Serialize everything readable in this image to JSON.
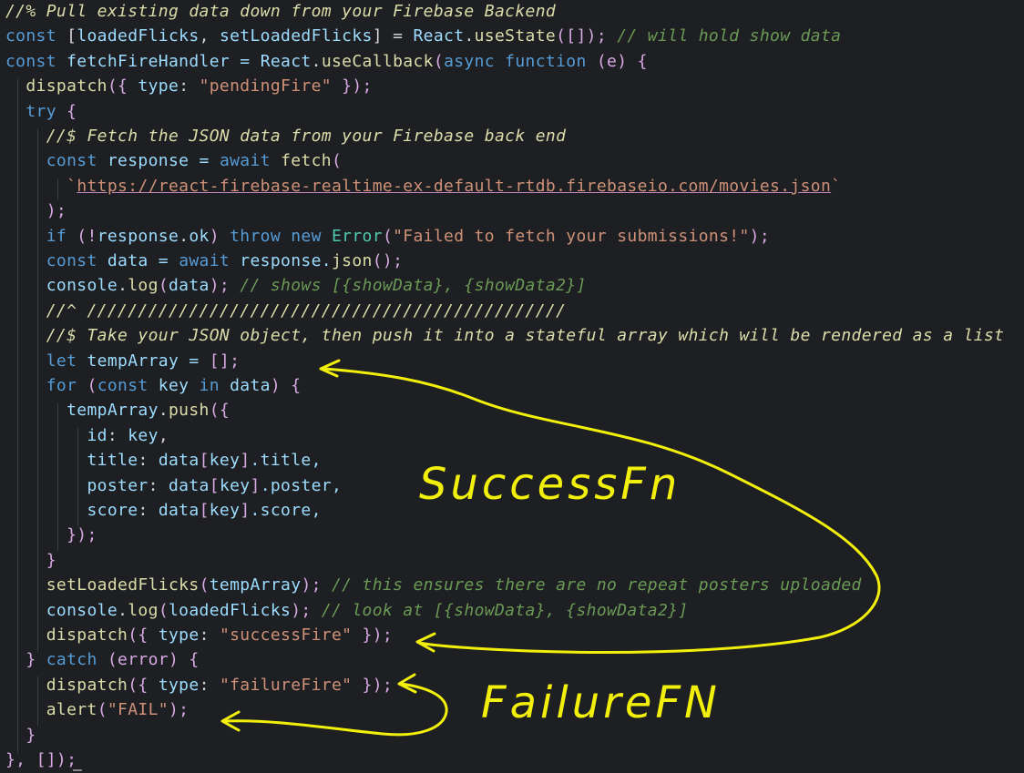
{
  "colors": {
    "background": "#1e1f22",
    "comment_green": "#6a9955",
    "keyword_blue": "#569cd6",
    "function_yellow": "#dcdcaa",
    "string_orange": "#ce9178",
    "annotation_yellow": "#f2f00b"
  },
  "code_lines": [
    [
      {
        "t": "//% Pull existing data down from your Firebase Backend",
        "c": "ch"
      }
    ],
    [
      {
        "t": "const",
        "c": "kw"
      },
      {
        "t": " [",
        "c": "p"
      },
      {
        "t": "loadedFlicks",
        "c": "v"
      },
      {
        "t": ", ",
        "c": "p"
      },
      {
        "t": "setLoadedFlicks",
        "c": "v"
      },
      {
        "t": "] = ",
        "c": "p"
      },
      {
        "t": "React",
        "c": "v"
      },
      {
        "t": ".",
        "c": "p"
      },
      {
        "t": "useState",
        "c": "fn"
      },
      {
        "t": "([]); ",
        "c": "br"
      },
      {
        "t": "// will hold show data",
        "c": "cm"
      }
    ],
    [
      {
        "t": "const",
        "c": "kw"
      },
      {
        "t": " fetchFireHandler = ",
        "c": "v"
      },
      {
        "t": "React",
        "c": "v"
      },
      {
        "t": ".",
        "c": "p"
      },
      {
        "t": "useCallback",
        "c": "fn"
      },
      {
        "t": "(",
        "c": "br"
      },
      {
        "t": "async function",
        "c": "kw"
      },
      {
        "t": " (e) {",
        "c": "br"
      }
    ],
    [
      {
        "t": "  ",
        "c": "p"
      },
      {
        "t": "dispatch",
        "c": "fn"
      },
      {
        "t": "({ ",
        "c": "br"
      },
      {
        "t": "type",
        "c": "v"
      },
      {
        "t": ": ",
        "c": "p"
      },
      {
        "t": "\"pendingFire\"",
        "c": "str"
      },
      {
        "t": " });",
        "c": "br"
      }
    ],
    [
      {
        "t": "  ",
        "c": "p"
      },
      {
        "t": "try",
        "c": "kw"
      },
      {
        "t": " {",
        "c": "br"
      }
    ],
    [
      {
        "t": "    ",
        "c": "p"
      },
      {
        "t": "//$ Fetch the JSON data from your Firebase back end",
        "c": "ch"
      }
    ],
    [
      {
        "t": "    ",
        "c": "p"
      },
      {
        "t": "const",
        "c": "kw"
      },
      {
        "t": " response = ",
        "c": "v"
      },
      {
        "t": "await",
        "c": "kw"
      },
      {
        "t": " ",
        "c": "p"
      },
      {
        "t": "fetch",
        "c": "fn"
      },
      {
        "t": "(",
        "c": "br"
      }
    ],
    [
      {
        "t": "      ",
        "c": "p"
      },
      {
        "t": "`",
        "c": "str"
      },
      {
        "t": "https://react-firebase-realtime-ex-default-rtdb.firebaseio.com/movies.json",
        "c": "url"
      },
      {
        "t": "`",
        "c": "str"
      }
    ],
    [
      {
        "t": "    ",
        "c": "p"
      },
      {
        "t": ");",
        "c": "br"
      }
    ],
    [
      {
        "t": "    ",
        "c": "p"
      },
      {
        "t": "if",
        "c": "kw"
      },
      {
        "t": " (!",
        "c": "br"
      },
      {
        "t": "response",
        "c": "v"
      },
      {
        "t": ".",
        "c": "p"
      },
      {
        "t": "ok",
        "c": "v"
      },
      {
        "t": ") ",
        "c": "br"
      },
      {
        "t": "throw new",
        "c": "kw"
      },
      {
        "t": " ",
        "c": "p"
      },
      {
        "t": "Error",
        "c": "cls"
      },
      {
        "t": "(",
        "c": "br"
      },
      {
        "t": "\"Failed to fetch your submissions!\"",
        "c": "str"
      },
      {
        "t": ");",
        "c": "br"
      }
    ],
    [
      {
        "t": "    ",
        "c": "p"
      },
      {
        "t": "const",
        "c": "kw"
      },
      {
        "t": " data = ",
        "c": "v"
      },
      {
        "t": "await",
        "c": "kw"
      },
      {
        "t": " response.",
        "c": "v"
      },
      {
        "t": "json",
        "c": "fn"
      },
      {
        "t": "();",
        "c": "br"
      }
    ],
    [
      {
        "t": "    ",
        "c": "p"
      },
      {
        "t": "console",
        "c": "v"
      },
      {
        "t": ".",
        "c": "p"
      },
      {
        "t": "log",
        "c": "fn"
      },
      {
        "t": "(",
        "c": "br"
      },
      {
        "t": "data",
        "c": "v"
      },
      {
        "t": "); ",
        "c": "br"
      },
      {
        "t": "// shows [{showData}, {showData2}]",
        "c": "cm"
      }
    ],
    [
      {
        "t": "    ",
        "c": "p"
      },
      {
        "t": "//^ ///////////////////////////////////////////////",
        "c": "ch"
      }
    ],
    [
      {
        "t": "    ",
        "c": "p"
      },
      {
        "t": "//$ Take your JSON object, then push it into a stateful array which will be rendered as a list",
        "c": "ch"
      }
    ],
    [
      {
        "t": "    ",
        "c": "p"
      },
      {
        "t": "let",
        "c": "kw"
      },
      {
        "t": " tempArray = ",
        "c": "v"
      },
      {
        "t": "[];",
        "c": "br"
      }
    ],
    [
      {
        "t": "    ",
        "c": "p"
      },
      {
        "t": "for",
        "c": "kw"
      },
      {
        "t": " (",
        "c": "br"
      },
      {
        "t": "const",
        "c": "kw"
      },
      {
        "t": " key ",
        "c": "v"
      },
      {
        "t": "in",
        "c": "kw"
      },
      {
        "t": " data",
        "c": "v"
      },
      {
        "t": ") {",
        "c": "br"
      }
    ],
    [
      {
        "t": "      ",
        "c": "p"
      },
      {
        "t": "tempArray",
        "c": "v"
      },
      {
        "t": ".",
        "c": "p"
      },
      {
        "t": "push",
        "c": "fn"
      },
      {
        "t": "({",
        "c": "br"
      }
    ],
    [
      {
        "t": "        ",
        "c": "p"
      },
      {
        "t": "id",
        "c": "v"
      },
      {
        "t": ": ",
        "c": "p"
      },
      {
        "t": "key",
        "c": "v"
      },
      {
        "t": ",",
        "c": "p"
      }
    ],
    [
      {
        "t": "        ",
        "c": "p"
      },
      {
        "t": "title",
        "c": "v"
      },
      {
        "t": ": ",
        "c": "p"
      },
      {
        "t": "data",
        "c": "v"
      },
      {
        "t": "[",
        "c": "br"
      },
      {
        "t": "key",
        "c": "v"
      },
      {
        "t": "]",
        "c": "br"
      },
      {
        "t": ".title,",
        "c": "v"
      }
    ],
    [
      {
        "t": "        ",
        "c": "p"
      },
      {
        "t": "poster",
        "c": "v"
      },
      {
        "t": ": ",
        "c": "p"
      },
      {
        "t": "data",
        "c": "v"
      },
      {
        "t": "[",
        "c": "br"
      },
      {
        "t": "key",
        "c": "v"
      },
      {
        "t": "]",
        "c": "br"
      },
      {
        "t": ".poster,",
        "c": "v"
      }
    ],
    [
      {
        "t": "        ",
        "c": "p"
      },
      {
        "t": "score",
        "c": "v"
      },
      {
        "t": ": ",
        "c": "p"
      },
      {
        "t": "data",
        "c": "v"
      },
      {
        "t": "[",
        "c": "br"
      },
      {
        "t": "key",
        "c": "v"
      },
      {
        "t": "]",
        "c": "br"
      },
      {
        "t": ".score,",
        "c": "v"
      }
    ],
    [
      {
        "t": "      ",
        "c": "p"
      },
      {
        "t": "});",
        "c": "br"
      }
    ],
    [
      {
        "t": "    ",
        "c": "p"
      },
      {
        "t": "}",
        "c": "br"
      }
    ],
    [
      {
        "t": "    ",
        "c": "p"
      },
      {
        "t": "setLoadedFlicks",
        "c": "fn"
      },
      {
        "t": "(",
        "c": "br"
      },
      {
        "t": "tempArray",
        "c": "v"
      },
      {
        "t": "); ",
        "c": "br"
      },
      {
        "t": "// this ensures there are no repeat posters uploaded",
        "c": "cm"
      }
    ],
    [
      {
        "t": "    ",
        "c": "p"
      },
      {
        "t": "console",
        "c": "v"
      },
      {
        "t": ".",
        "c": "p"
      },
      {
        "t": "log",
        "c": "fn"
      },
      {
        "t": "(",
        "c": "br"
      },
      {
        "t": "loadedFlicks",
        "c": "v"
      },
      {
        "t": "); ",
        "c": "br"
      },
      {
        "t": "// look at [{showData}, {showData2}]",
        "c": "cm"
      }
    ],
    [
      {
        "t": "    ",
        "c": "p"
      },
      {
        "t": "dispatch",
        "c": "fn"
      },
      {
        "t": "({ ",
        "c": "br"
      },
      {
        "t": "type",
        "c": "v"
      },
      {
        "t": ": ",
        "c": "p"
      },
      {
        "t": "\"successFire\"",
        "c": "str"
      },
      {
        "t": " });",
        "c": "br"
      }
    ],
    [
      {
        "t": "  ",
        "c": "p"
      },
      {
        "t": "} ",
        "c": "br"
      },
      {
        "t": "catch",
        "c": "kw"
      },
      {
        "t": " (error) {",
        "c": "br"
      }
    ],
    [
      {
        "t": "    ",
        "c": "p"
      },
      {
        "t": "dispatch",
        "c": "fn"
      },
      {
        "t": "({ ",
        "c": "br"
      },
      {
        "t": "type",
        "c": "v"
      },
      {
        "t": ": ",
        "c": "p"
      },
      {
        "t": "\"failureFire\"",
        "c": "str"
      },
      {
        "t": " });",
        "c": "br"
      }
    ],
    [
      {
        "t": "    ",
        "c": "p"
      },
      {
        "t": "alert",
        "c": "fn"
      },
      {
        "t": "(",
        "c": "br"
      },
      {
        "t": "\"FAIL\"",
        "c": "str"
      },
      {
        "t": ");",
        "c": "br"
      }
    ],
    [
      {
        "t": "  ",
        "c": "p"
      },
      {
        "t": "}",
        "c": "br"
      }
    ],
    [
      {
        "t": "}, ",
        "c": "br"
      },
      {
        "t": "[]);",
        "c": "br"
      }
    ]
  ],
  "annotations": {
    "success_label": "SuccessFn",
    "failure_label": "FailureFN"
  }
}
